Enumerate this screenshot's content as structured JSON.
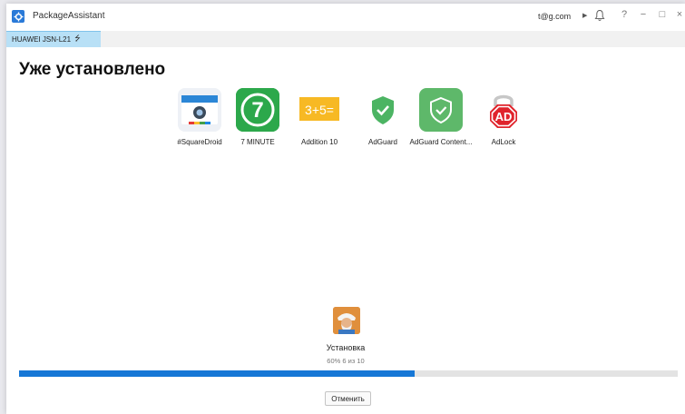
{
  "window": {
    "title": "PackageAssistant"
  },
  "header": {
    "account": "t@g.com",
    "help": "?",
    "minimize": "−",
    "maximize": "□",
    "close": "×"
  },
  "device": {
    "tab_label": "HUAWEI JSN-L21"
  },
  "main": {
    "heading": "Уже установлено",
    "apps": [
      {
        "label": "#SquareDroid",
        "icon": "squaredroid-icon"
      },
      {
        "label": "7 MINUTE",
        "icon": "seven-minute-icon"
      },
      {
        "label": "Addition 10",
        "icon": "addition-icon"
      },
      {
        "label": "AdGuard",
        "icon": "adguard-shield-icon"
      },
      {
        "label": "AdGuard Content...",
        "icon": "adguard-content-icon"
      },
      {
        "label": "AdLock",
        "icon": "adlock-icon"
      }
    ],
    "seven_text": "7",
    "addition_text": "3+5="
  },
  "install": {
    "title": "Установка",
    "progress_text": "60% 6 из 10",
    "progress_percent": 60,
    "cancel_label": "Отменить"
  },
  "colors": {
    "accent": "#1677d6",
    "device_tab": "#b8e0f6"
  }
}
